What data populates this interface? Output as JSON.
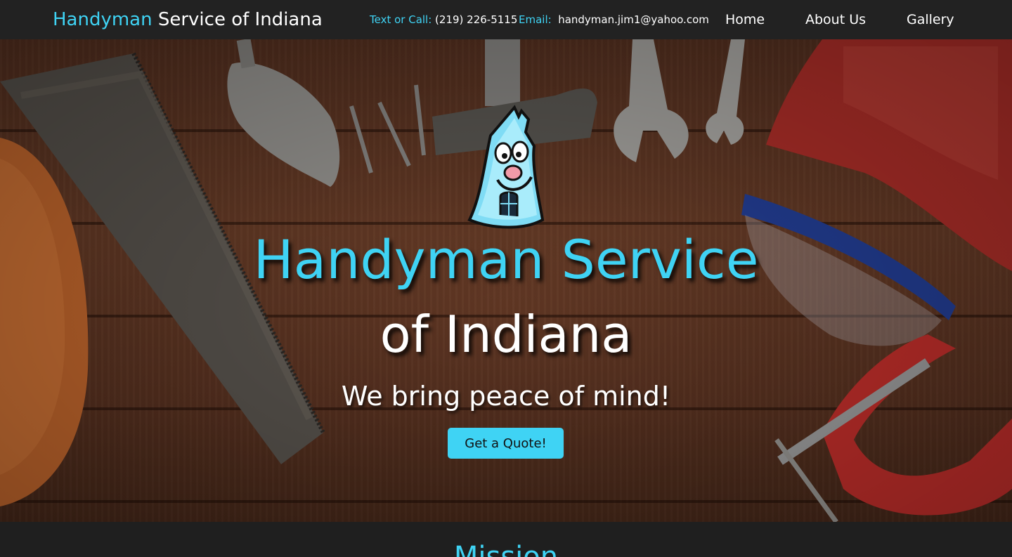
{
  "nav": {
    "brand_accent": "Handyman",
    "brand_rest": " Service of Indiana",
    "phone_label": "Text or Call:",
    "phone_value": " (219) 226-5115",
    "email_label": "Email:",
    "email_value": "  handyman.jim1@yahoo.com",
    "links": [
      {
        "label": "Home"
      },
      {
        "label": "About Us"
      },
      {
        "label": "Gallery"
      }
    ]
  },
  "hero": {
    "title_line1": "Handyman Service",
    "title_line2": "of Indiana",
    "tagline": "We bring peace of mind!",
    "cta_label": "Get a Quote!",
    "background_icon": "tools-on-wood-background",
    "mascot_icon": "smiling-house-mascot-icon"
  },
  "mission": {
    "title": "Mission"
  },
  "colors": {
    "accent": "#3fd3f4",
    "nav_bg": "#222222",
    "page_bg": "#1f1f1f",
    "button_text": "#111111"
  }
}
